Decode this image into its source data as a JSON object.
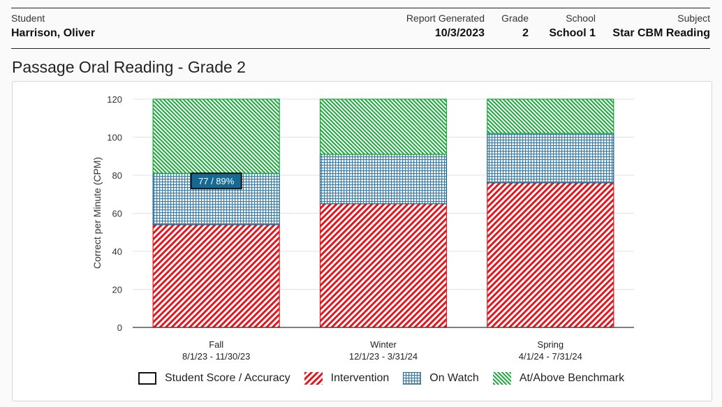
{
  "header": {
    "student_label": "Student",
    "student_value": "Harrison, Oliver",
    "report_label": "Report Generated",
    "report_value": "10/3/2023",
    "grade_label": "Grade",
    "grade_value": "2",
    "school_label": "School",
    "school_value": "School 1",
    "subject_label": "Subject",
    "subject_value": "Star CBM Reading"
  },
  "page_title": "Passage Oral Reading - Grade 2",
  "colors": {
    "intervention": "#e8141c",
    "on_watch": "#1a5f8a",
    "benchmark": "#1aa83a",
    "score_label_bg": "#156a93"
  },
  "chart_data": {
    "type": "bar",
    "stacked": true,
    "title": "Passage Oral Reading - Grade 2",
    "xlabel": "",
    "ylabel": "Correct per Minute (CPM)",
    "ylim": [
      0,
      120
    ],
    "yticks": [
      0,
      20,
      40,
      60,
      80,
      100,
      120
    ],
    "grid": true,
    "categories": [
      "Fall",
      "Winter",
      "Spring"
    ],
    "category_dates": [
      "8/1/23 - 11/30/23",
      "12/1/23 - 3/31/24",
      "4/1/24 - 7/31/24"
    ],
    "series": [
      {
        "name": "Intervention",
        "values": [
          54,
          65,
          76
        ]
      },
      {
        "name": "On Watch",
        "values": [
          27,
          26,
          26
        ]
      },
      {
        "name": "At/Above Benchmark",
        "values": [
          39,
          29,
          18
        ]
      }
    ],
    "student_scores": [
      {
        "category": "Fall",
        "score": 77,
        "accuracy": "89%",
        "label": "77 / 89%"
      }
    ],
    "legend": {
      "placement": "bottom",
      "items": [
        "Student Score / Accuracy",
        "Intervention",
        "On Watch",
        "At/Above Benchmark"
      ]
    }
  }
}
